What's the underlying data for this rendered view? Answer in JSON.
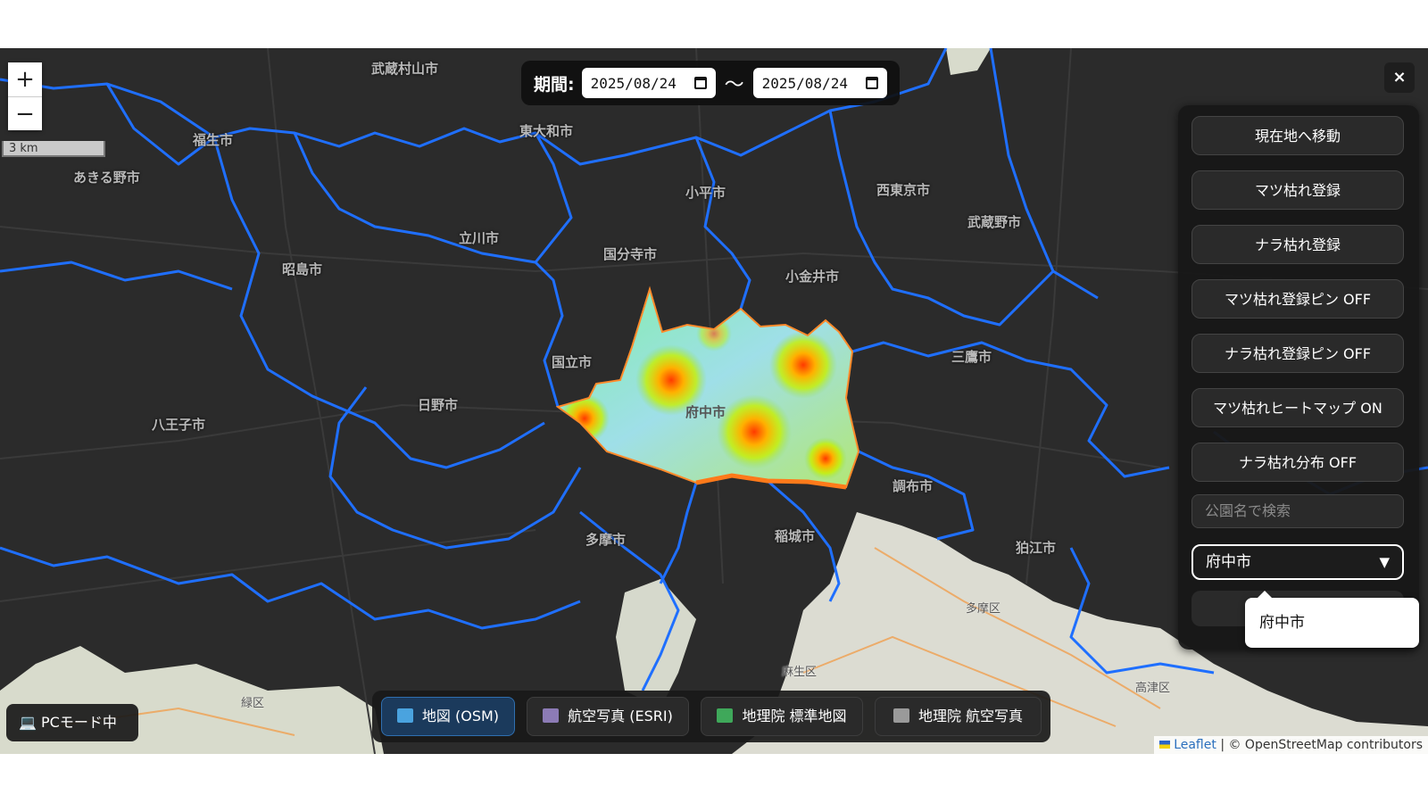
{
  "map": {
    "zoom_in": "+",
    "zoom_out": "−",
    "scale_text": "3 km",
    "city_labels": [
      "武蔵村山市",
      "東大和市",
      "福生市",
      "あきる野市",
      "立川市",
      "昭島市",
      "小平市",
      "西東京市",
      "国分寺市",
      "小金井市",
      "武蔵野市",
      "国立市",
      "府中市",
      "三鷹市",
      "日野市",
      "八王子市",
      "調布市",
      "多摩市",
      "稲城市",
      "狛江市",
      "多摩区",
      "麻生区",
      "高津区",
      "緑区"
    ]
  },
  "date_filter": {
    "label": "期間:",
    "start": "2025/08/24",
    "separator": "〜",
    "end": "2025/08/24"
  },
  "close_label": "×",
  "panel": {
    "buttons": [
      "現在地へ移動",
      "マツ枯れ登録",
      "ナラ枯れ登録",
      "マツ枯れ登録ピン OFF",
      "ナラ枯れ登録ピン OFF",
      "マツ枯れヒートマップ ON",
      "ナラ枯れ分布 OFF"
    ],
    "search_placeholder": "公園名で検索",
    "city_select_value": "府中市",
    "dropdown_option": "府中市"
  },
  "mode_badge": "💻 PCモード中",
  "layers": [
    {
      "label": "地図 (OSM)",
      "icon": "map-icon",
      "active": true
    },
    {
      "label": "航空写真 (ESRI)",
      "icon": "satellite-icon",
      "active": false
    },
    {
      "label": "地理院 標準地図",
      "icon": "japan-map-icon",
      "active": false
    },
    {
      "label": "地理院 航空写真",
      "icon": "camera-icon",
      "active": false
    }
  ],
  "attribution": {
    "leaflet": "Leaflet",
    "osm": "| © OpenStreetMap contributors"
  },
  "colors": {
    "boundary": "#1f6fff",
    "highlight_outline": "#ff7a1a",
    "active_layer": "#1b3a5c"
  }
}
